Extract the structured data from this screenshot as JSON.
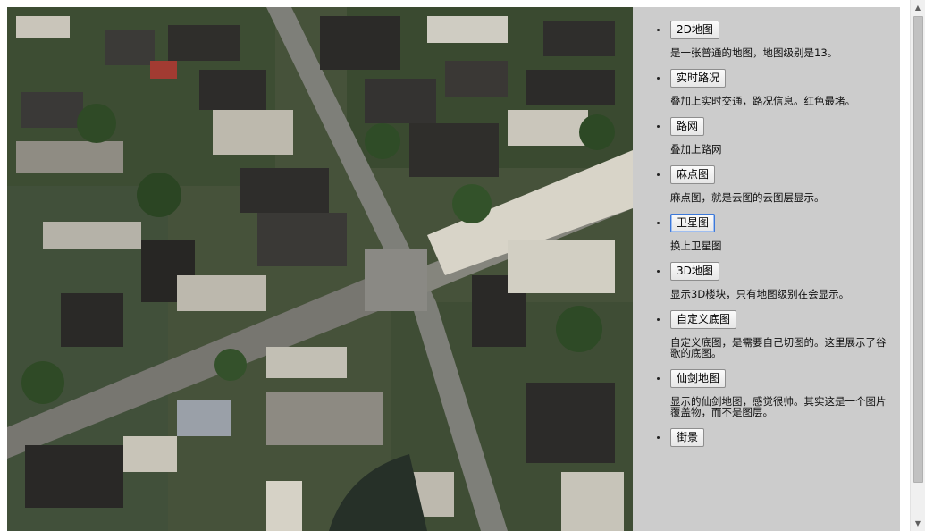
{
  "map": {
    "view": "satellite-imagery"
  },
  "panel": {
    "items": [
      {
        "button": "2D地图",
        "desc": "是一张普通的地图，地图级别是13。"
      },
      {
        "button": "实时路况",
        "desc": "叠加上实时交通，路况信息。红色最堵。"
      },
      {
        "button": "路网",
        "desc": "叠加上路网"
      },
      {
        "button": "麻点图",
        "desc": "麻点图，就是云图的云图层显示。"
      },
      {
        "button": "卫星图",
        "desc": "换上卫星图"
      },
      {
        "button": "3D地图",
        "desc": "显示3D楼块，只有地图级别在会显示。"
      },
      {
        "button": "自定义底图",
        "desc": "自定义底图，是需要自己切图的。这里展示了谷歌的底图。"
      },
      {
        "button": "仙剑地图",
        "desc": "显示的仙剑地图，感觉很帅。其实这是一个图片覆盖物，而不是图层。"
      },
      {
        "button": "街景",
        "desc": ""
      }
    ]
  },
  "colors": {
    "panel_bg": "#cccccc",
    "focus": "#3c78d8"
  },
  "icons": {
    "scroll_up": "scroll-up-arrow-icon",
    "scroll_down": "scroll-down-arrow-icon"
  }
}
